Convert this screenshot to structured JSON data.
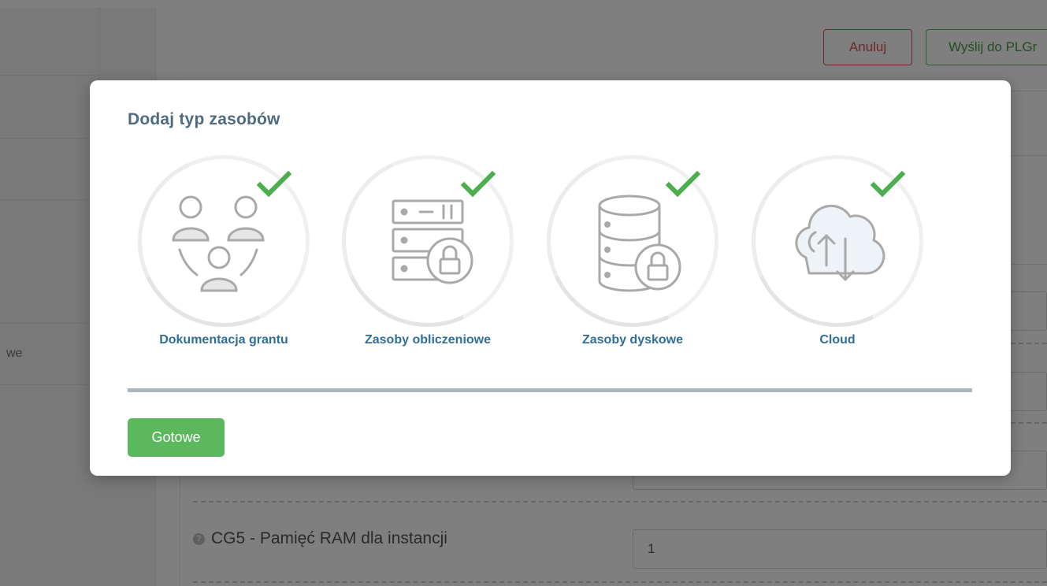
{
  "background": {
    "header": {
      "cancel_label": "Anuluj",
      "send_label": "Wyślij do PLGr"
    },
    "sidebar": {
      "partial_label": "we"
    },
    "form": {
      "row_label": "CG5 - Pamięć RAM dla instancji",
      "row_value": "1"
    }
  },
  "modal": {
    "title": "Dodaj typ zasobów",
    "tiles": [
      {
        "label": "Dokumentacja grantu",
        "icon": "users-group-icon",
        "checked": true
      },
      {
        "label": "Zasoby obliczeniowe",
        "icon": "server-lock-icon",
        "checked": true
      },
      {
        "label": "Zasoby dyskowe",
        "icon": "database-lock-icon",
        "checked": true
      },
      {
        "label": "Cloud",
        "icon": "cloud-sync-icon",
        "checked": true
      }
    ],
    "done_label": "Gotowe"
  },
  "colors": {
    "accent_green": "#5cb85c",
    "check_green": "#4cae4c",
    "danger_red": "#d9534f",
    "label_blue": "#2f6f99",
    "title_slate": "#4f6b80"
  }
}
